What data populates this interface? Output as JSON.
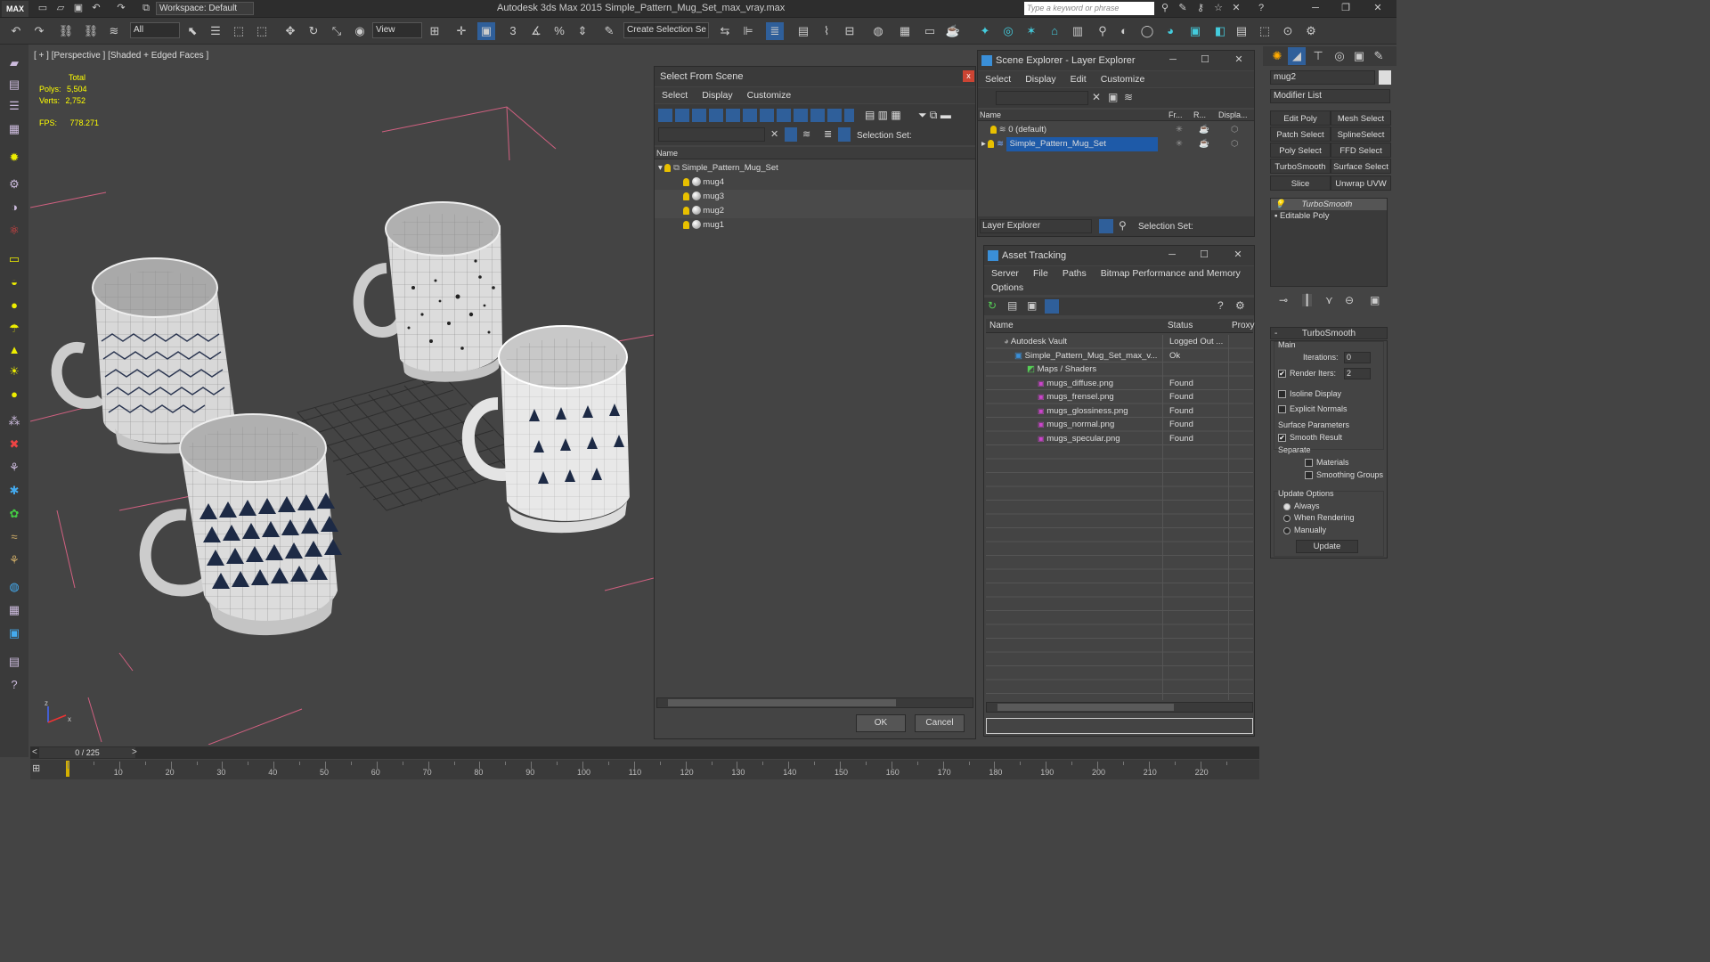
{
  "app": {
    "logo_text": "MAX",
    "workspace": "Workspace: Default",
    "title": "Autodesk 3ds Max  2015     Simple_Pattern_Mug_Set_max_vray.max",
    "search_placeholder": "Type a keyword or phrase"
  },
  "toolbar": {
    "filter_select": "All",
    "ref_coord": "View",
    "named_sel": "Create Selection Se",
    "snap_label": "3",
    "angle_snap": "n",
    "percent_snap": "%"
  },
  "viewport": {
    "label": "[ + ] [Perspective ] [Shaded + Edged Faces ]",
    "stats_header": "Total",
    "polys_label": "Polys:",
    "polys_value": "5,504",
    "verts_label": "Verts:",
    "verts_value": "2,752",
    "fps_label": "FPS:",
    "fps_value": "778.271",
    "axis_z": "z",
    "axis_x": "x"
  },
  "select_dialog": {
    "title": "Select From Scene",
    "close": "x",
    "menu": [
      "Select",
      "Display",
      "Customize"
    ],
    "selection_set_label": "Selection Set:",
    "column_name": "Name",
    "tree_root": "Simple_Pattern_Mug_Set",
    "items": [
      "mug4",
      "mug3",
      "mug2",
      "mug1"
    ],
    "ok": "OK",
    "cancel": "Cancel"
  },
  "scene_explorer": {
    "title": "Scene Explorer - Layer Explorer",
    "menu": [
      "Select",
      "Display",
      "Edit",
      "Customize"
    ],
    "columns": [
      "Name",
      "Fr...",
      "R...",
      "Displa..."
    ],
    "layers": [
      "0 (default)",
      "Simple_Pattern_Mug_Set"
    ],
    "footer_label": "Layer Explorer",
    "selection_set_label": "Selection Set:"
  },
  "asset_tracking": {
    "title": "Asset Tracking",
    "menu": [
      "Server",
      "File",
      "Paths",
      "Bitmap Performance and Memory"
    ],
    "menu2": "Options",
    "columns": [
      "Name",
      "Status",
      "Proxy"
    ],
    "rows": [
      {
        "name": "Autodesk Vault",
        "status": "Logged Out ..."
      },
      {
        "name": "Simple_Pattern_Mug_Set_max_v...",
        "status": "Ok"
      },
      {
        "name": "Maps / Shaders",
        "status": ""
      },
      {
        "name": "mugs_diffuse.png",
        "status": "Found"
      },
      {
        "name": "mugs_frensel.png",
        "status": "Found"
      },
      {
        "name": "mugs_glossiness.png",
        "status": "Found"
      },
      {
        "name": "mugs_normal.png",
        "status": "Found"
      },
      {
        "name": "mugs_specular.png",
        "status": "Found"
      }
    ]
  },
  "command_panel": {
    "object_name": "mug2",
    "modifier_list": "Modifier List",
    "buttons": [
      "Edit Poly",
      "Mesh Select",
      "Patch Select",
      "SplineSelect",
      "Poly Select",
      "FFD Select",
      "TurboSmooth",
      "Surface Select",
      "Slice",
      "Unwrap UVW"
    ],
    "stack": [
      "TurboSmooth",
      "Editable Poly"
    ],
    "rollout_title": "TurboSmooth",
    "main_label": "Main",
    "iterations_label": "Iterations:",
    "iterations_value": "0",
    "render_iters_label": "Render Iters:",
    "render_iters_value": "2",
    "isoline": "Isoline Display",
    "explicit_normals": "Explicit Normals",
    "surface_params": "Surface Parameters",
    "smooth_result": "Smooth Result",
    "separate": "Separate",
    "materials": "Materials",
    "smoothing_groups": "Smoothing Groups",
    "update_options": "Update Options",
    "always": "Always",
    "when_rendering": "When Rendering",
    "manually": "Manually",
    "update_btn": "Update"
  },
  "timeline": {
    "frame": "0 / 225",
    "ticks": [
      "10",
      "20",
      "30",
      "40",
      "50",
      "60",
      "70",
      "80",
      "90",
      "100",
      "110",
      "120",
      "130",
      "140",
      "150",
      "160",
      "170",
      "180",
      "190",
      "200",
      "210",
      "220"
    ]
  }
}
